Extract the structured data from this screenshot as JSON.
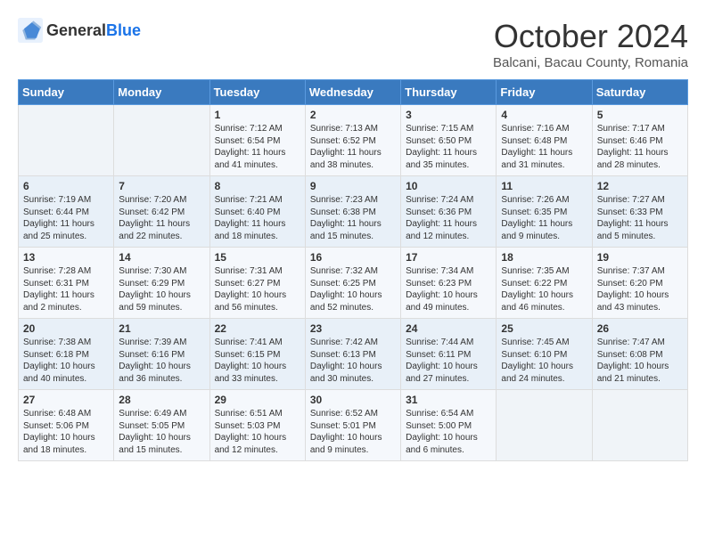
{
  "header": {
    "logo_general": "General",
    "logo_blue": "Blue",
    "month_title": "October 2024",
    "subtitle": "Balcani, Bacau County, Romania"
  },
  "days_of_week": [
    "Sunday",
    "Monday",
    "Tuesday",
    "Wednesday",
    "Thursday",
    "Friday",
    "Saturday"
  ],
  "weeks": [
    [
      {
        "day": "",
        "sunrise": "",
        "sunset": "",
        "daylight": ""
      },
      {
        "day": "",
        "sunrise": "",
        "sunset": "",
        "daylight": ""
      },
      {
        "day": "1",
        "sunrise": "Sunrise: 7:12 AM",
        "sunset": "Sunset: 6:54 PM",
        "daylight": "Daylight: 11 hours and 41 minutes."
      },
      {
        "day": "2",
        "sunrise": "Sunrise: 7:13 AM",
        "sunset": "Sunset: 6:52 PM",
        "daylight": "Daylight: 11 hours and 38 minutes."
      },
      {
        "day": "3",
        "sunrise": "Sunrise: 7:15 AM",
        "sunset": "Sunset: 6:50 PM",
        "daylight": "Daylight: 11 hours and 35 minutes."
      },
      {
        "day": "4",
        "sunrise": "Sunrise: 7:16 AM",
        "sunset": "Sunset: 6:48 PM",
        "daylight": "Daylight: 11 hours and 31 minutes."
      },
      {
        "day": "5",
        "sunrise": "Sunrise: 7:17 AM",
        "sunset": "Sunset: 6:46 PM",
        "daylight": "Daylight: 11 hours and 28 minutes."
      }
    ],
    [
      {
        "day": "6",
        "sunrise": "Sunrise: 7:19 AM",
        "sunset": "Sunset: 6:44 PM",
        "daylight": "Daylight: 11 hours and 25 minutes."
      },
      {
        "day": "7",
        "sunrise": "Sunrise: 7:20 AM",
        "sunset": "Sunset: 6:42 PM",
        "daylight": "Daylight: 11 hours and 22 minutes."
      },
      {
        "day": "8",
        "sunrise": "Sunrise: 7:21 AM",
        "sunset": "Sunset: 6:40 PM",
        "daylight": "Daylight: 11 hours and 18 minutes."
      },
      {
        "day": "9",
        "sunrise": "Sunrise: 7:23 AM",
        "sunset": "Sunset: 6:38 PM",
        "daylight": "Daylight: 11 hours and 15 minutes."
      },
      {
        "day": "10",
        "sunrise": "Sunrise: 7:24 AM",
        "sunset": "Sunset: 6:36 PM",
        "daylight": "Daylight: 11 hours and 12 minutes."
      },
      {
        "day": "11",
        "sunrise": "Sunrise: 7:26 AM",
        "sunset": "Sunset: 6:35 PM",
        "daylight": "Daylight: 11 hours and 9 minutes."
      },
      {
        "day": "12",
        "sunrise": "Sunrise: 7:27 AM",
        "sunset": "Sunset: 6:33 PM",
        "daylight": "Daylight: 11 hours and 5 minutes."
      }
    ],
    [
      {
        "day": "13",
        "sunrise": "Sunrise: 7:28 AM",
        "sunset": "Sunset: 6:31 PM",
        "daylight": "Daylight: 11 hours and 2 minutes."
      },
      {
        "day": "14",
        "sunrise": "Sunrise: 7:30 AM",
        "sunset": "Sunset: 6:29 PM",
        "daylight": "Daylight: 10 hours and 59 minutes."
      },
      {
        "day": "15",
        "sunrise": "Sunrise: 7:31 AM",
        "sunset": "Sunset: 6:27 PM",
        "daylight": "Daylight: 10 hours and 56 minutes."
      },
      {
        "day": "16",
        "sunrise": "Sunrise: 7:32 AM",
        "sunset": "Sunset: 6:25 PM",
        "daylight": "Daylight: 10 hours and 52 minutes."
      },
      {
        "day": "17",
        "sunrise": "Sunrise: 7:34 AM",
        "sunset": "Sunset: 6:23 PM",
        "daylight": "Daylight: 10 hours and 49 minutes."
      },
      {
        "day": "18",
        "sunrise": "Sunrise: 7:35 AM",
        "sunset": "Sunset: 6:22 PM",
        "daylight": "Daylight: 10 hours and 46 minutes."
      },
      {
        "day": "19",
        "sunrise": "Sunrise: 7:37 AM",
        "sunset": "Sunset: 6:20 PM",
        "daylight": "Daylight: 10 hours and 43 minutes."
      }
    ],
    [
      {
        "day": "20",
        "sunrise": "Sunrise: 7:38 AM",
        "sunset": "Sunset: 6:18 PM",
        "daylight": "Daylight: 10 hours and 40 minutes."
      },
      {
        "day": "21",
        "sunrise": "Sunrise: 7:39 AM",
        "sunset": "Sunset: 6:16 PM",
        "daylight": "Daylight: 10 hours and 36 minutes."
      },
      {
        "day": "22",
        "sunrise": "Sunrise: 7:41 AM",
        "sunset": "Sunset: 6:15 PM",
        "daylight": "Daylight: 10 hours and 33 minutes."
      },
      {
        "day": "23",
        "sunrise": "Sunrise: 7:42 AM",
        "sunset": "Sunset: 6:13 PM",
        "daylight": "Daylight: 10 hours and 30 minutes."
      },
      {
        "day": "24",
        "sunrise": "Sunrise: 7:44 AM",
        "sunset": "Sunset: 6:11 PM",
        "daylight": "Daylight: 10 hours and 27 minutes."
      },
      {
        "day": "25",
        "sunrise": "Sunrise: 7:45 AM",
        "sunset": "Sunset: 6:10 PM",
        "daylight": "Daylight: 10 hours and 24 minutes."
      },
      {
        "day": "26",
        "sunrise": "Sunrise: 7:47 AM",
        "sunset": "Sunset: 6:08 PM",
        "daylight": "Daylight: 10 hours and 21 minutes."
      }
    ],
    [
      {
        "day": "27",
        "sunrise": "Sunrise: 6:48 AM",
        "sunset": "Sunset: 5:06 PM",
        "daylight": "Daylight: 10 hours and 18 minutes."
      },
      {
        "day": "28",
        "sunrise": "Sunrise: 6:49 AM",
        "sunset": "Sunset: 5:05 PM",
        "daylight": "Daylight: 10 hours and 15 minutes."
      },
      {
        "day": "29",
        "sunrise": "Sunrise: 6:51 AM",
        "sunset": "Sunset: 5:03 PM",
        "daylight": "Daylight: 10 hours and 12 minutes."
      },
      {
        "day": "30",
        "sunrise": "Sunrise: 6:52 AM",
        "sunset": "Sunset: 5:01 PM",
        "daylight": "Daylight: 10 hours and 9 minutes."
      },
      {
        "day": "31",
        "sunrise": "Sunrise: 6:54 AM",
        "sunset": "Sunset: 5:00 PM",
        "daylight": "Daylight: 10 hours and 6 minutes."
      },
      {
        "day": "",
        "sunrise": "",
        "sunset": "",
        "daylight": ""
      },
      {
        "day": "",
        "sunrise": "",
        "sunset": "",
        "daylight": ""
      }
    ]
  ]
}
